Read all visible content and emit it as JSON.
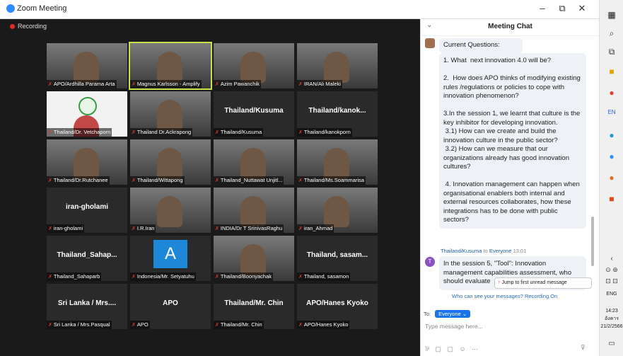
{
  "window": {
    "title": "Zoom Meeting",
    "minimize": "–",
    "restore": "⧉",
    "close": "✕"
  },
  "recording": "Recording",
  "tiles": [
    {
      "name": "APO/Ardhilla Parama Arta",
      "style": "v"
    },
    {
      "name": "Magnus Karlsson - Amplify",
      "style": "v",
      "active": true
    },
    {
      "name": "Azim Pawanchik",
      "style": "v"
    },
    {
      "name": "IRAN/Ali Maleki",
      "style": "v"
    },
    {
      "name": "Thailand/Dr. Vetchaporn",
      "style": "logo"
    },
    {
      "name": "Thailand Dr.Ackrapong",
      "style": "v"
    },
    {
      "name": "Thailand/Kusuma",
      "big": "Thailand/Kusuma"
    },
    {
      "name": "Thailand/kanokporn",
      "big": "Thailand/kanok..."
    },
    {
      "name": "Thailand/Dr.Rutchanee",
      "style": "v"
    },
    {
      "name": "Thailand/Wittapong",
      "style": "v"
    },
    {
      "name": "Thailand_Nuttawat Unjitl...",
      "style": "v"
    },
    {
      "name": "Thailand/Ms.Soammarisa",
      "style": "v"
    },
    {
      "name": "iran-gholami",
      "big": "iran-gholami"
    },
    {
      "name": "I.R.Iran",
      "style": "v"
    },
    {
      "name": "INDIA/Dr T SrinivasRaghu",
      "style": "v"
    },
    {
      "name": "iran_Ahmad",
      "style": "v"
    },
    {
      "name": "Thailand_Sahaparb",
      "big": "Thailand_Sahap..."
    },
    {
      "name": "Indonesia/Mr. Setyatuhu",
      "style": "avatar",
      "letter": "A"
    },
    {
      "name": "Thailand/Boonyachak",
      "style": "v"
    },
    {
      "name": "Thailand, sasamon",
      "big": "Thailand, sasam..."
    },
    {
      "name": "Sri Lanka / Mrs.Pasqual",
      "big": "Sri Lanka / Mrs...."
    },
    {
      "name": "APO",
      "big": "APO"
    },
    {
      "name": "Thailand/Mr. Chin",
      "big": "Thailand/Mr. Chin"
    },
    {
      "name": "APO/Hanes Kyoko",
      "big": "APO/Hanes Kyoko"
    }
  ],
  "chat": {
    "title": "Meeting Chat",
    "msg1_header": "Current Questions:",
    "msg1_body": "1. What  next innovation 4.0 will be?\n\n2.  How does APO thinks of modifying existing  rules /regulations or policies to cope with innovation phenomenon?\n\n3.In the session 1, we learnt that culture is the key inhibitor for developing innovation.\n 3.1) How can we create and build the innovation culture in the public sector?\n 3.2) How can we measure that our organizations already has good innovation cultures?\n\n 4. Innovation management can happen when organisational enablers both internal and external resources collaborates, how these integrations has to be done with public sectors?",
    "msg2_from": "Thailand/Kusuma",
    "msg2_to_word": "to",
    "msg2_to": "Everyone",
    "msg2_time": "13:01",
    "msg2_avatar": "T",
    "msg2_body": "In the session 5, \"Tool\": Innovation management capabilities assessment, who should evaluate",
    "jump": "Jump to first unread message",
    "who_can_see": "Who can see your messages? Recording On",
    "to_label": "To:",
    "to_value": "Everyone ⌄",
    "placeholder": "Type message here...",
    "tools": "⅌ ▢ ▢ ☺ ⋯",
    "send": "⊽"
  },
  "taskbar": {
    "lang": "ENG",
    "time": "14:23",
    "day": "อังคาร",
    "date": "21/2/2566"
  }
}
